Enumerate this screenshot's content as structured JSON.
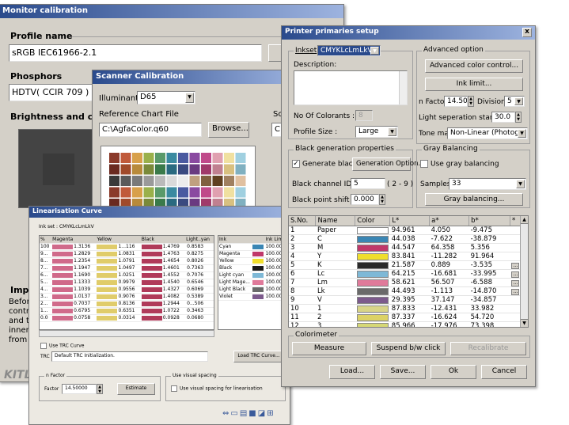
{
  "monitor": {
    "title": "Monitor calibration",
    "profile_label": "Profile name",
    "profile_value": "sRGB IEC61966-2.1",
    "phosphors_label": "Phosphors",
    "phosphors_value": "HDTV( CCIR 709 )",
    "brightness_label": "Brightness and con",
    "imp_label": "Imp",
    "imp_text_lines": [
      "Befor",
      "contra",
      "and th",
      "innem",
      "from t"
    ],
    "logo_text": "KITL"
  },
  "scanner": {
    "title": "Scanner Calibration",
    "illuminant_label": "Illuminant :",
    "illuminant_value": "D65",
    "ref_chart_label": "Reference Chart File",
    "file_value": "C:\\AgfaColor.q60",
    "browse_label": "Browse...",
    "sc_label": "Sc",
    "c_value": "C:"
  },
  "lin": {
    "title": "Linearisation Curve",
    "inkset_label": "Ink set : CMYKLcLmLkV",
    "columns": [
      "%",
      "Magenta",
      "Yellow",
      "Black",
      "Light..yan"
    ],
    "rows": [
      [
        "100",
        "1.3136",
        "1...116",
        "1.4769",
        "0.8583"
      ],
      [
        "9...",
        "1.2829",
        "1.0831",
        "1.4763",
        "0.8275"
      ],
      [
        "8...",
        "1.2354",
        "1.0791",
        "1.4654",
        "0.8026"
      ],
      [
        "7...",
        "1.1947",
        "1.0497",
        "1.4601",
        "0.7363"
      ],
      [
        "6...",
        "1.1690",
        "1.0251",
        "1.4552",
        "0.7076"
      ],
      [
        "5...",
        "1.1333",
        "0.9979",
        "1.4540",
        "0.6546"
      ],
      [
        "4...",
        "1.1039",
        "0.9556",
        "1.4327",
        "0.6069"
      ],
      [
        "3...",
        "1.0137",
        "0.9076",
        "1.4082",
        "0.5389"
      ],
      [
        "2...",
        "0.7037",
        "0.8136",
        "1.2944",
        "0...506"
      ],
      [
        "1...",
        "0.6795",
        "0.6351",
        "1.0722",
        "0.3463"
      ],
      [
        "0.0",
        "0.0758",
        "0.0314",
        "0.0928",
        "0.0680"
      ]
    ],
    "ink_columns": [
      "Ink",
      "",
      "Ink Limi"
    ],
    "ink_rows": [
      [
        "Cyan",
        "100.000"
      ],
      [
        "Magenta",
        "100.000"
      ],
      [
        "Yellow",
        "100.000"
      ],
      [
        "Black",
        "100.000"
      ],
      [
        "Light cyan",
        "100.000"
      ],
      [
        "Light Mage...",
        "100.000"
      ],
      [
        "Light Black",
        "100.000"
      ],
      [
        "Violet",
        "100.000"
      ]
    ],
    "use_trc_label": "Use TRC Curve",
    "trc_label": "TRC",
    "trc_value": "Default TRC Initialization.",
    "load_trc_label": "Load TRC Curve...",
    "nfactor_group": "n Factor",
    "factor_label": "Factor",
    "factor_value": "14.50000",
    "estimate_label": "Estimate",
    "visual_group": "Use visual spacing",
    "visual_label": "Use visual spacing for linearisation"
  },
  "printer": {
    "title": "Printer primaries setup",
    "close": "x",
    "inkset_label": "Inkset",
    "inkset_value": "CMYKLcLmLkV",
    "description_label": "Description:",
    "no_colorants_label": "No Of Colorants :",
    "no_colorants_value": "8",
    "profile_size_label": "Profile Size :",
    "profile_size_value": "Large",
    "advanced_group": "Advanced option",
    "advanced_btn": "Advanced color control...",
    "ink_limit_btn": "Ink limit...",
    "nfactor_label": "n Factor",
    "nfactor_value": "14.500",
    "division_label": "Division",
    "division_value": "5",
    "light_sep_label": "Light seperation start (L*)",
    "light_sep_value": "30.0",
    "tone_map_label": "Tone map",
    "tone_map_value": "Non-Linear (Photogra",
    "black_group": "Black generation properties",
    "generate_black_label": "Generate black",
    "generation_option_btn": "Generation Option...",
    "black_channel_label": "Black channel ID :",
    "black_channel_value": "5",
    "black_channel_range": "( 2 - 9 )",
    "black_point_label": "Black point shift :",
    "black_point_value": "0.000",
    "gray_group": "Gray Balancing",
    "use_gray_label": "Use gray balancing",
    "samples_label": "Samples :",
    "samples_value": "33",
    "gray_btn": "Gray balancing...",
    "table_columns": [
      "S.No.",
      "Name",
      "Color",
      "L*",
      "a*",
      "b*",
      "*"
    ],
    "table_rows": [
      {
        "no": "1",
        "name": "Paper",
        "color": "#ffffff",
        "L": "94.961",
        "a": "4.050",
        "b": "-9.475",
        "more": false
      },
      {
        "no": "2",
        "name": "C",
        "color": "#3a86b4",
        "L": "44.038",
        "a": "-7.622",
        "b": "-38.879",
        "more": false
      },
      {
        "no": "3",
        "name": "M",
        "color": "#c0386a",
        "L": "44.547",
        "a": "64.358",
        "b": "5.356",
        "more": false
      },
      {
        "no": "4",
        "name": "Y",
        "color": "#f0de2c",
        "L": "83.841",
        "a": "-11.282",
        "b": "91.964",
        "more": false
      },
      {
        "no": "5",
        "name": "K",
        "color": "#2a2a2a",
        "L": "21.587",
        "a": "0.889",
        "b": "-3.535",
        "more": true
      },
      {
        "no": "6",
        "name": "Lc",
        "color": "#7eb8d6",
        "L": "64.215",
        "a": "-16.681",
        "b": "-33.995",
        "more": true
      },
      {
        "no": "7",
        "name": "Lm",
        "color": "#e07a9a",
        "L": "58.621",
        "a": "56.507",
        "b": "-6.588",
        "more": true
      },
      {
        "no": "8",
        "name": "Lk",
        "color": "#6a6a6a",
        "L": "44.493",
        "a": "-1.113",
        "b": "-14.870",
        "more": true
      },
      {
        "no": "9",
        "name": "V",
        "color": "#7c5a8c",
        "L": "29.395",
        "a": "37.147",
        "b": "-34.857",
        "more": false
      },
      {
        "no": "10",
        "name": "1",
        "color": "#d8d488",
        "L": "87.833",
        "a": "-12.431",
        "b": "33.982",
        "more": false
      },
      {
        "no": "11",
        "name": "2",
        "color": "#dcd266",
        "L": "87.337",
        "a": "-16.624",
        "b": "54.720",
        "more": false
      },
      {
        "no": "12",
        "name": "3",
        "color": "#d6d876",
        "L": "85.966",
        "a": "-17.976",
        "b": "73.398",
        "more": false
      }
    ],
    "colorimeter_group": "Colorimeter",
    "measure_btn": "Measure",
    "suspend_btn": "Suspend b/w click",
    "recalibrate_btn": "Recalibrate",
    "load_btn": "Load...",
    "save_btn": "Save...",
    "ok_btn": "Ok",
    "cancel_btn": "Cancel"
  }
}
